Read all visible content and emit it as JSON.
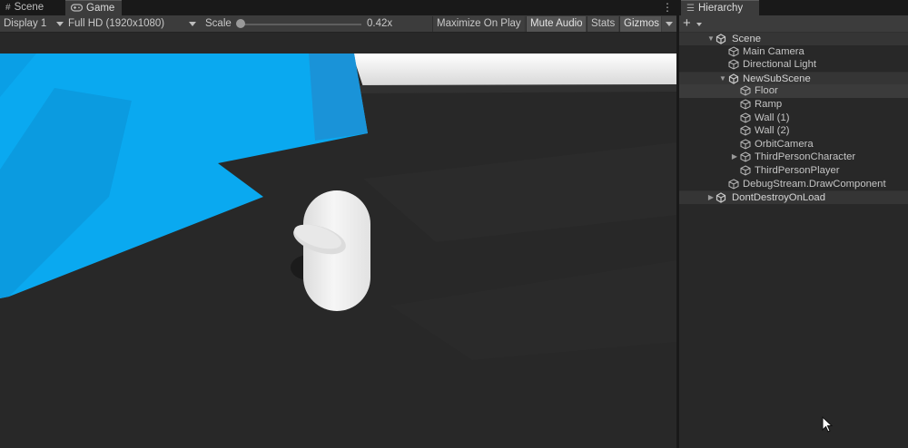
{
  "game": {
    "tabs": [
      {
        "label": "Scene",
        "icon": "grid-icon"
      },
      {
        "label": "Game",
        "icon": "gamepad-icon"
      }
    ],
    "toolbar": {
      "display": "Display 1",
      "resolution": "Full HD (1920x1080)",
      "scale_label": "Scale",
      "scale_value": "0.42x",
      "maximize": "Maximize On Play",
      "mute": "Mute Audio",
      "stats": "Stats",
      "gizmos": "Gizmos"
    }
  },
  "hierarchy": {
    "tab_label": "Hierarchy",
    "add_label": "+",
    "rows": [
      {
        "label": "Scene",
        "kind": "scene",
        "expanded": true,
        "header": true
      },
      {
        "label": "Main Camera",
        "kind": "object"
      },
      {
        "label": "Directional Light",
        "kind": "object"
      },
      {
        "label": "NewSubScene",
        "kind": "subscene",
        "expanded": true,
        "header": true
      },
      {
        "label": "Floor",
        "kind": "object",
        "selected": true
      },
      {
        "label": "Ramp",
        "kind": "object"
      },
      {
        "label": "Wall (1)",
        "kind": "object"
      },
      {
        "label": "Wall (2)",
        "kind": "object"
      },
      {
        "label": "OrbitCamera",
        "kind": "object"
      },
      {
        "label": "ThirdPersonCharacter",
        "kind": "object",
        "expanded": false
      },
      {
        "label": "ThirdPersonPlayer",
        "kind": "object"
      },
      {
        "label": "DebugStream.DrawComponent",
        "kind": "object"
      },
      {
        "label": "DontDestroyOnLoad",
        "kind": "scene",
        "expanded": false,
        "header": true
      }
    ]
  },
  "colors": {
    "ramp_blue": "#0aa7ee",
    "floor": "#282828",
    "wall": "#f4f4f4",
    "capsule": "#ececec"
  }
}
